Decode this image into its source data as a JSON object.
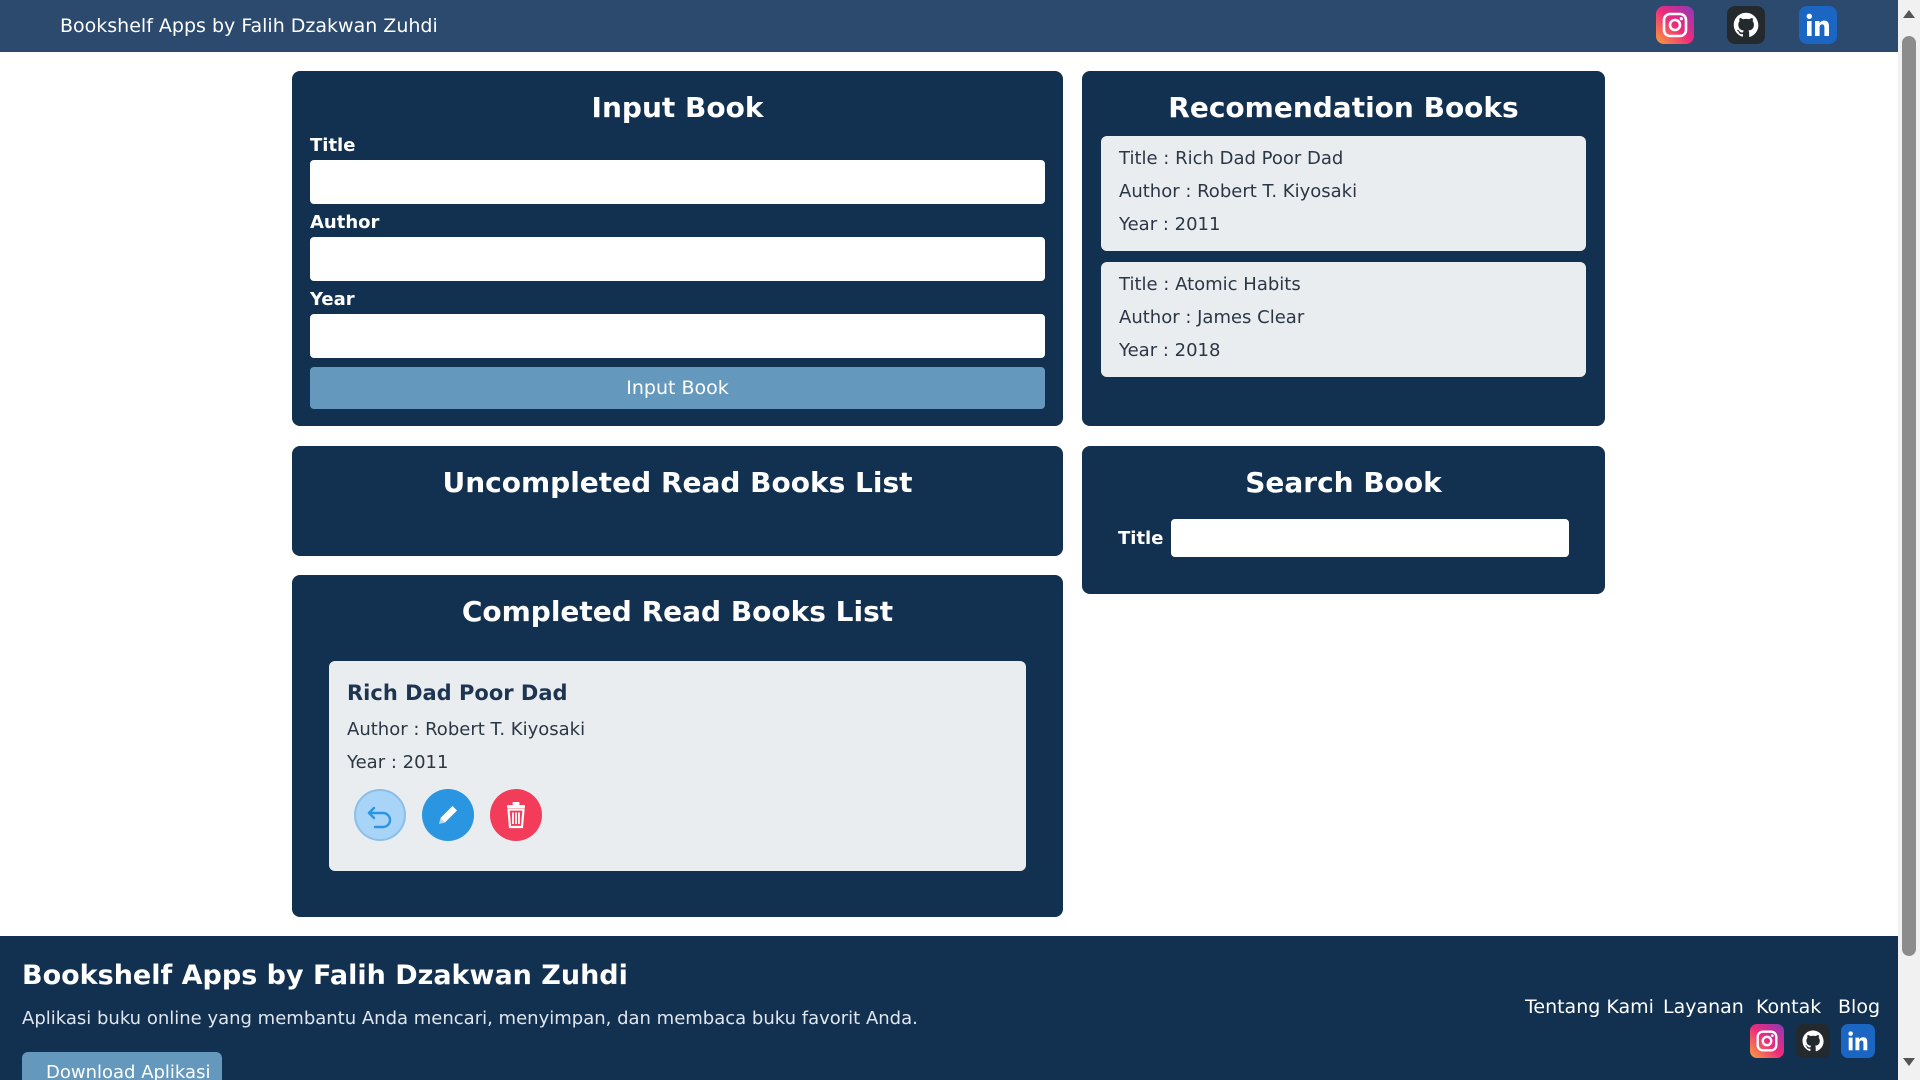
{
  "header": {
    "title": "Bookshelf Apps by Falih Dzakwan Zuhdi",
    "social_icons": [
      "instagram-icon",
      "github-icon",
      "linkedin-icon"
    ]
  },
  "input_book": {
    "heading": "Input Book",
    "title_label": "Title",
    "title_value": "",
    "author_label": "Author",
    "author_value": "",
    "year_label": "Year",
    "year_value": "",
    "submit_label": "Input Book"
  },
  "recommendations": {
    "heading": "Recomendation Books",
    "books": [
      {
        "title": "Title : Rich Dad Poor Dad",
        "author": "Author : Robert T. Kiyosaki",
        "year": "Year : 2011"
      },
      {
        "title": "Title : Atomic Habits",
        "author": "Author : James Clear",
        "year": "Year : 2018"
      }
    ]
  },
  "uncompleted": {
    "heading": "Uncompleted Read Books List"
  },
  "search": {
    "heading": "Search Book",
    "title_label": "Title",
    "title_value": ""
  },
  "completed": {
    "heading": "Completed Read Books List",
    "books": [
      {
        "title": "Rich Dad Poor Dad",
        "author": "Author : Robert T. Kiyosaki",
        "year": "Year : 2011",
        "actions": [
          "undo-icon",
          "edit-icon",
          "trash-icon"
        ]
      }
    ]
  },
  "footer": {
    "title": "Bookshelf Apps by Falih Dzakwan Zuhdi",
    "description": "Aplikasi buku online yang membantu Anda mencari, menyimpan, dan membaca buku favorit Anda.",
    "download_label": "Download Aplikasi",
    "links": [
      "Tentang Kami",
      "Layanan",
      "Kontak",
      "Blog"
    ],
    "social_icons": [
      "instagram-icon",
      "github-icon",
      "linkedin-icon"
    ]
  },
  "colors": {
    "navbar": "#2b4a6e",
    "panel": "#12304f",
    "button": "#6598bd",
    "card": "#e9edf0",
    "edit": "#2a95e0",
    "delete": "#f23c5a",
    "undo": "#a7d4f7"
  }
}
